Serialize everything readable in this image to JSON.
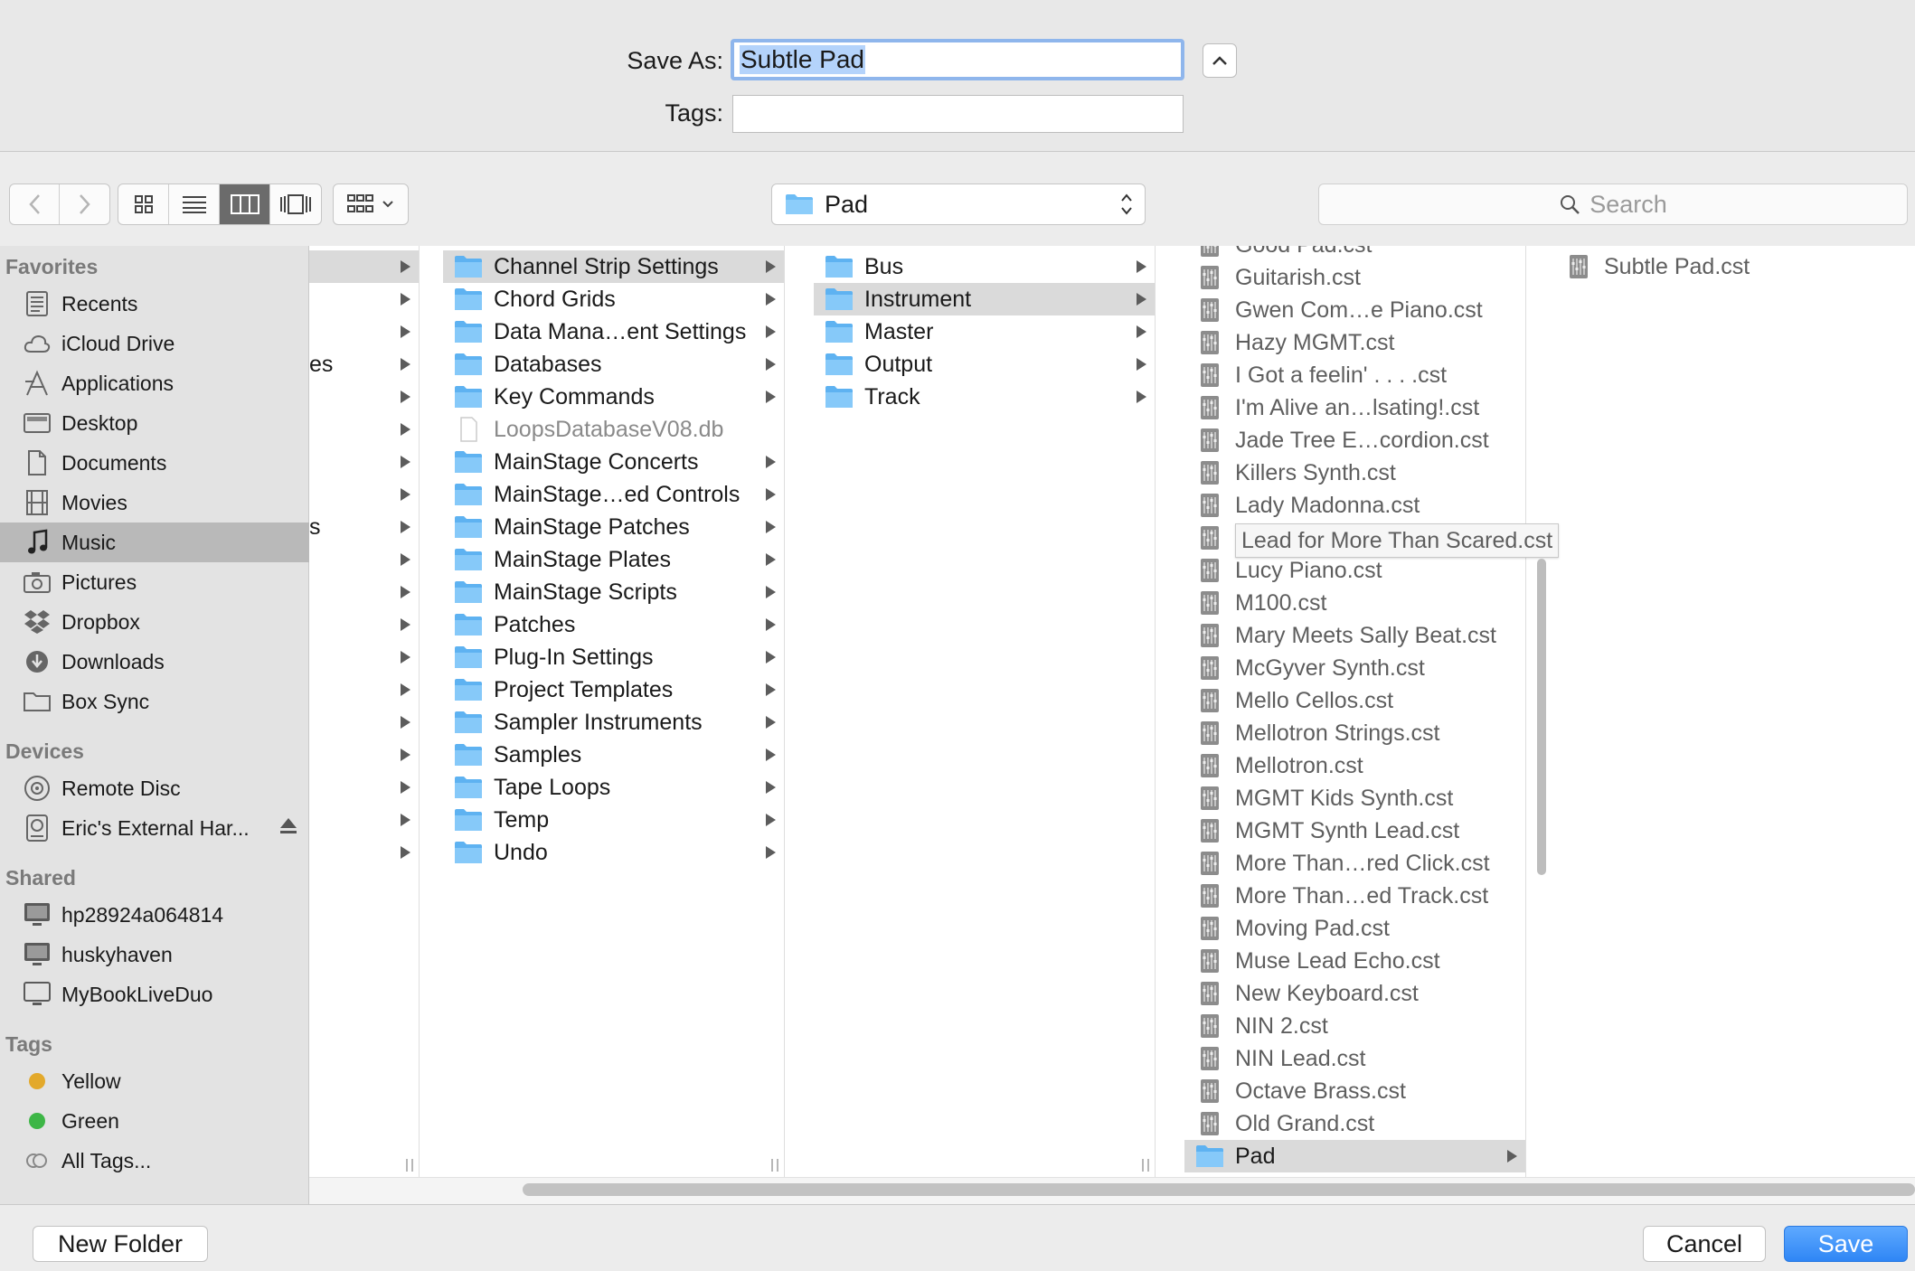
{
  "save_as": {
    "label": "Save As:",
    "value": "Subtle Pad"
  },
  "tags": {
    "label": "Tags:",
    "value": ""
  },
  "toolbar": {
    "path_popup": "Pad",
    "search_placeholder": "Search"
  },
  "sidebar": {
    "sections": [
      {
        "title": "Favorites",
        "items": [
          "Recents",
          "iCloud Drive",
          "Applications",
          "Desktop",
          "Documents",
          "Movies",
          "Music",
          "Pictures",
          "Dropbox",
          "Downloads",
          "Box Sync"
        ]
      },
      {
        "title": "Devices",
        "items": [
          "Remote Disc",
          "Eric's External Har..."
        ]
      },
      {
        "title": "Shared",
        "items": [
          "hp28924a064814",
          "huskyhaven",
          "MyBookLiveDuo"
        ]
      },
      {
        "title": "Tags",
        "items": [
          "Yellow",
          "Green",
          "All Tags..."
        ]
      }
    ],
    "selected": "Music",
    "tag_colors": {
      "yellow": "#e3a92b",
      "green": "#3db646"
    }
  },
  "columns": {
    "col1_fragments": [
      "",
      "",
      "",
      "es",
      "",
      "",
      "",
      "",
      "s"
    ],
    "col2": [
      "Channel Strip Settings",
      "Chord Grids",
      "Data Mana…ent Settings",
      "Databases",
      "Key Commands",
      "LoopsDatabaseV08.db",
      "MainStage Concerts",
      "MainStage…ed Controls",
      "MainStage Patches",
      "MainStage Plates",
      "MainStage Scripts",
      "Patches",
      "Plug-In Settings",
      "Project Templates",
      "Sampler Instruments",
      "Samples",
      "Tape Loops",
      "Temp",
      "Undo"
    ],
    "col3": [
      "Bus",
      "Instrument",
      "Master",
      "Output",
      "Track"
    ],
    "col4": [
      "Good Pad.cst",
      "Guitarish.cst",
      "Gwen Com…e Piano.cst",
      "Hazy MGMT.cst",
      "I Got a feelin' . . . .cst",
      "I'm Alive an…lsating!.cst",
      "Jade Tree E…cordion.cst",
      "Killers Synth.cst",
      "Lady Madonna.cst",
      "",
      "Lucy Piano.cst",
      "M100.cst",
      "Mary Meets Sally Beat.cst",
      "McGyver Synth.cst",
      "Mello Cellos.cst",
      "Mellotron Strings.cst",
      "Mellotron.cst",
      "MGMT Kids Synth.cst",
      "MGMT Synth Lead.cst",
      "More Than…red Click.cst",
      "More Than…ed Track.cst",
      "Moving Pad.cst",
      "Muse Lead Echo.cst",
      "New Keyboard.cst",
      "NIN 2.cst",
      "NIN Lead.cst",
      "Octave Brass.cst",
      "Old Grand.cst",
      "Pad"
    ],
    "col5": [
      "Subtle Pad.cst"
    ],
    "tooltip": "Lead for More Than Scared.cst"
  },
  "buttons": {
    "new_folder": "New Folder",
    "cancel": "Cancel",
    "save": "Save"
  }
}
